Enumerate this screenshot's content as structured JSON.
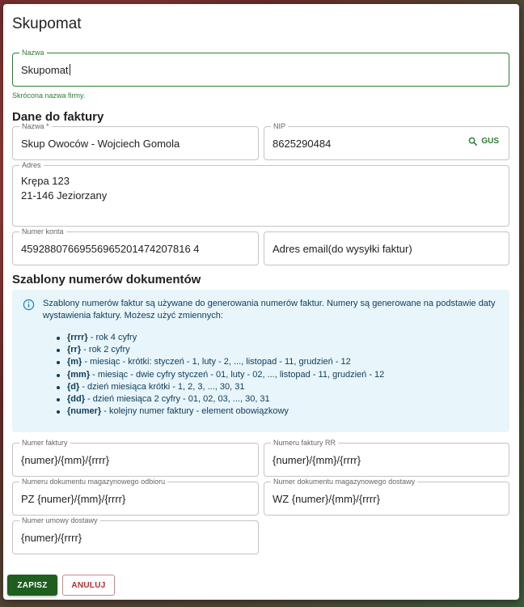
{
  "dialog": {
    "title": "Skupomat",
    "company_name": {
      "label": "Nazwa",
      "value": "Skupomat",
      "helper": "Skrócona nazwa firmy."
    },
    "invoice_section": {
      "heading": "Dane do faktury",
      "name": {
        "label": "Nazwa *",
        "value": "Skup Owoców - Wojciech Gomola"
      },
      "nip": {
        "label": "NIP",
        "value": "8625290484",
        "gus_label": "GUS"
      },
      "address": {
        "label": "Adres",
        "value": "Krępa 123\n21-146 Jeziorzany"
      },
      "account": {
        "label": "Numer konta",
        "value": "45928807669556965201474207816 4"
      },
      "email": {
        "placeholder": "Adres email(do wysyłki faktur)"
      }
    },
    "templates_section": {
      "heading": "Szablony numerów dokumentów",
      "info_text": "Szablony numerów faktur są używane do generowania numerów faktur. Numery są generowane na podstawie daty wystawienia faktury. Możesz użyć zmiennych:",
      "variables": [
        {
          "token": "{rrrr}",
          "desc": " - rok 4 cyfry"
        },
        {
          "token": "{rr}",
          "desc": " - rok 2 cyfry"
        },
        {
          "token": "{m}",
          "desc": " - miesiąc - krótki: styczeń - 1, luty - 2, ..., listopad - 11, grudzień - 12"
        },
        {
          "token": "{mm}",
          "desc": " - miesiąc - dwie cyfry styczeń - 01, luty - 02, ..., listopad - 11, grudzień - 12"
        },
        {
          "token": "{d}",
          "desc": " - dzień miesiąca krótki - 1, 2, 3, ..., 30, 31"
        },
        {
          "token": "{dd}",
          "desc": " - dzień miesiąca 2 cyfry - 01, 02, 03, ..., 30, 31"
        },
        {
          "token": "{numer}",
          "desc": " - kolejny numer faktury - element obowiązkowy"
        }
      ],
      "invoice_number": {
        "label": "Numer faktury",
        "value": "{numer}/{mm}/{rrrr}"
      },
      "invoice_rr_number": {
        "label": "Numeru faktury RR",
        "value": "{numer}/{mm}/{rrrr}"
      },
      "warehouse_receipt": {
        "label": "Numeru dokumentu magazynowego odbioru",
        "value": "PZ {numer}/{mm}/{rrrr}"
      },
      "warehouse_delivery": {
        "label": "Numer dokumentu magazynowego dostawy",
        "value": "WZ {numer}/{mm}/{rrrr}"
      },
      "contract_number": {
        "label": "Numer umowy dostawy",
        "value": "{numer}/{rrrr}"
      }
    },
    "actions": {
      "save": "ZAPISZ",
      "cancel": "ANULUJ"
    }
  },
  "colors": {
    "primary": "#1e5e1e",
    "focus": "#2e7d32",
    "cancel": "#b03030",
    "info_bg": "#e8f5fb"
  },
  "icons": {
    "gus": "search-icon",
    "info": "info-icon"
  }
}
